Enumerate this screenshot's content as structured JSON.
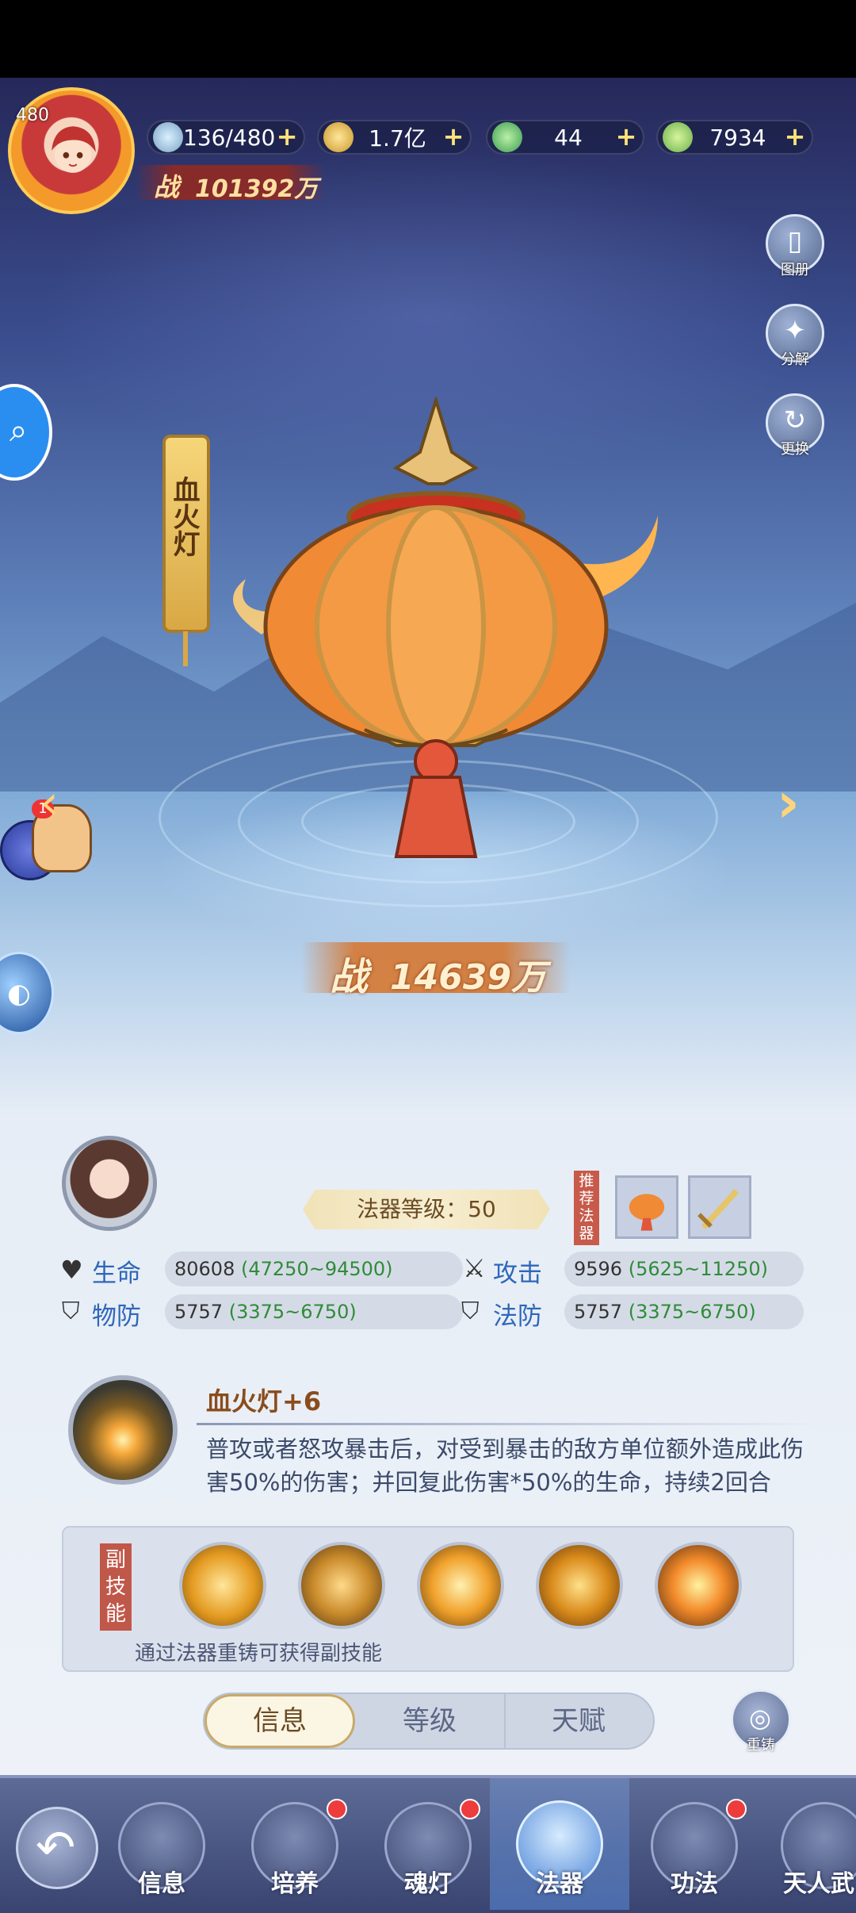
{
  "header": {
    "player_level": "480",
    "power_label": "战",
    "power_value": "101392万",
    "resources": [
      {
        "icon": "stamina-icon",
        "value": "136/480"
      },
      {
        "icon": "coin-icon",
        "value": "1.7亿"
      },
      {
        "icon": "jade-icon",
        "value": "44"
      },
      {
        "icon": "leaf-icon",
        "value": "7934"
      }
    ]
  },
  "side_buttons": [
    {
      "icon": "album-icon",
      "label": "图册"
    },
    {
      "icon": "decompose-icon",
      "label": "分解"
    },
    {
      "icon": "swap-icon",
      "label": "更换"
    }
  ],
  "artifact": {
    "name": "血火灯",
    "power_label": "战",
    "power_value": "14639万"
  },
  "snail_badge": "1",
  "info": {
    "level_text": "法器等级：50",
    "recommend_label": "推荐法器",
    "stats": [
      {
        "icon": "heart-icon",
        "label": "生命",
        "base": "80608",
        "range": "(47250~94500)"
      },
      {
        "icon": "sword-icon",
        "label": "攻击",
        "base": "9596",
        "range": "(5625~11250)"
      },
      {
        "icon": "shield-icon",
        "label": "物防",
        "base": "5757",
        "range": "(3375~6750)"
      },
      {
        "icon": "magic-shield-icon",
        "label": "法防",
        "base": "5757",
        "range": "(3375~6750)"
      }
    ],
    "skill_title": "血火灯+6",
    "skill_desc": "普攻或者怒攻暴击后，对受到暴击的敌方单位额外造成此伤害50%的伤害；并回复此伤害*50%的生命，持续2回合"
  },
  "sub_skills": {
    "label": "副技能",
    "note": "通过法器重铸可获得副技能"
  },
  "tabs": [
    {
      "label": "信息",
      "active": true
    },
    {
      "label": "等级",
      "active": false
    },
    {
      "label": "天赋",
      "active": false
    }
  ],
  "recast_label": "重铸",
  "nav": [
    {
      "label": "信息",
      "badge": false
    },
    {
      "label": "培养",
      "badge": true
    },
    {
      "label": "魂灯",
      "badge": true
    },
    {
      "label": "法器",
      "badge": false,
      "active": true
    },
    {
      "label": "功法",
      "badge": true
    },
    {
      "label": "天人武",
      "badge": false
    }
  ]
}
